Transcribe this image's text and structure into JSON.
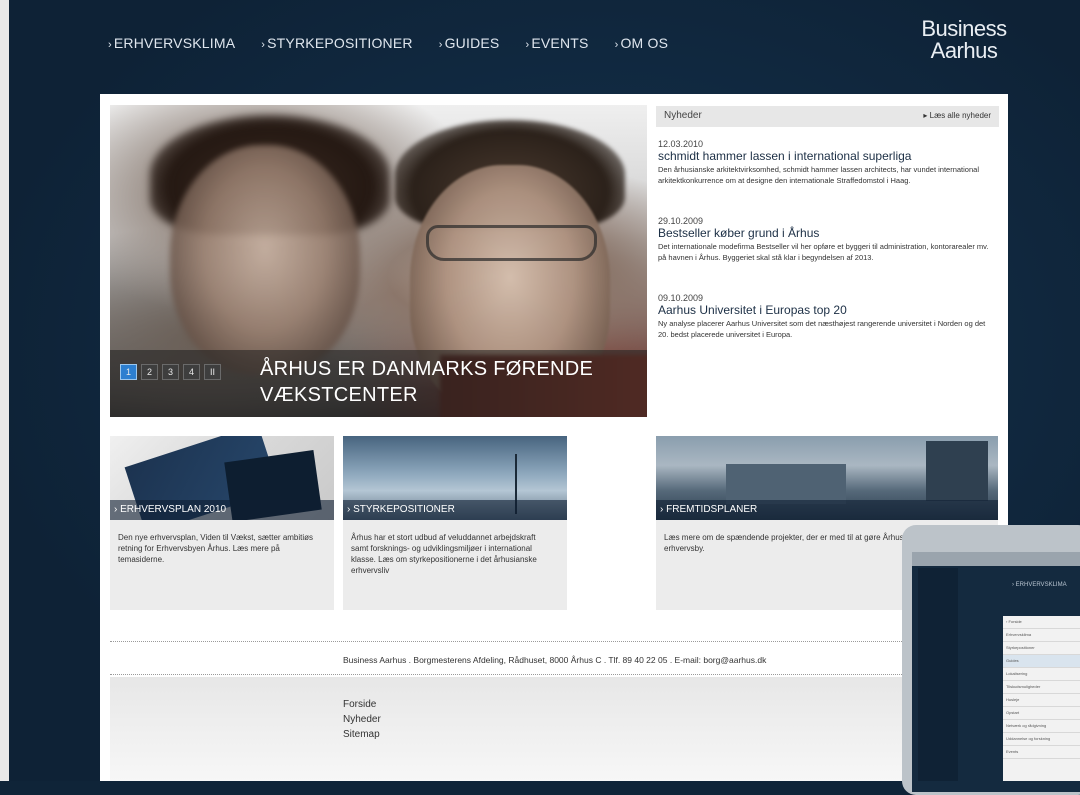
{
  "nav": {
    "items": [
      "ERHVERVSKLIMA",
      "STYRKEPOSITIONER",
      "GUIDES",
      "EVENTS",
      "OM OS"
    ],
    "caret": "›"
  },
  "logo": {
    "line1": "Business",
    "line2": "Aarhus"
  },
  "hero": {
    "slides": [
      "1",
      "2",
      "3",
      "4",
      "II"
    ],
    "title": "ÅRHUS ER DANMARKS FØRENDE VÆKSTCENTER"
  },
  "news": {
    "heading": "Nyheder",
    "all_link": "▸ Læs alle nyheder",
    "items": [
      {
        "date": "12.03.2010",
        "title": "schmidt hammer lassen i international superliga",
        "body": "Den århusianske arkitektvirksomhed, schmidt hammer lassen architects, har vundet international arkitektkonkurrence om at designe den internationale Straffedomstol i Haag."
      },
      {
        "date": "29.10.2009",
        "title": "Bestseller køber grund i Århus",
        "body": "Det internationale modefirma Bestseller vil her opføre et byggeri til administration, kontorarealer mv. på havnen i Århus. Byggeriet skal stå klar i begyndelsen af 2013."
      },
      {
        "date": "09.10.2009",
        "title": "Aarhus Universitet i Europas top 20",
        "body": "Ny analyse placerer Aarhus Universitet som det næsthøjest rangerende universitet i Norden og det 20. bedst placerede universitet i Europa."
      }
    ]
  },
  "boxes": [
    {
      "label": "› ERHVERVSPLAN 2010",
      "text": "Den nye erhvervsplan, Viden til Vækst, sætter ambitiøs retning for Erhvervsbyen Århus. Læs mere på temasiderne."
    },
    {
      "label": "› STYRKEPOSITIONER",
      "text": "Århus har et stort udbud af veluddannet arbejdskraft samt forsknings- og udviklingsmiljøer i international klasse. Læs om styrkepositionerne i det århusianske erhvervsliv"
    },
    {
      "label": "› FREMTIDSPLANER",
      "text": "Læs mere om de spændende projekter, der er med til at gøre Århus til en attraktiv erhvervsby."
    }
  ],
  "footer": {
    "contact": "Business Aarhus . Borgmesterens Afdeling, Rådhuset, 8000 Århus C . Tlf. 89 40 22 05 . E-mail: borg@aarhus.dk",
    "links": [
      "Forside",
      "Nyheder",
      "Sitemap"
    ]
  },
  "device": {
    "nav_text": "› ERHVERVSKLIMA",
    "menu": [
      "› Forside",
      "Erhvervsklima",
      "Styrkepositioner",
      "Guides",
      "Lokalisering",
      "Tilskudsmuligheder",
      "Husleje",
      "Opstart",
      "Netværk og rådgivning",
      "Uddannelse og forskning",
      "Events"
    ]
  }
}
